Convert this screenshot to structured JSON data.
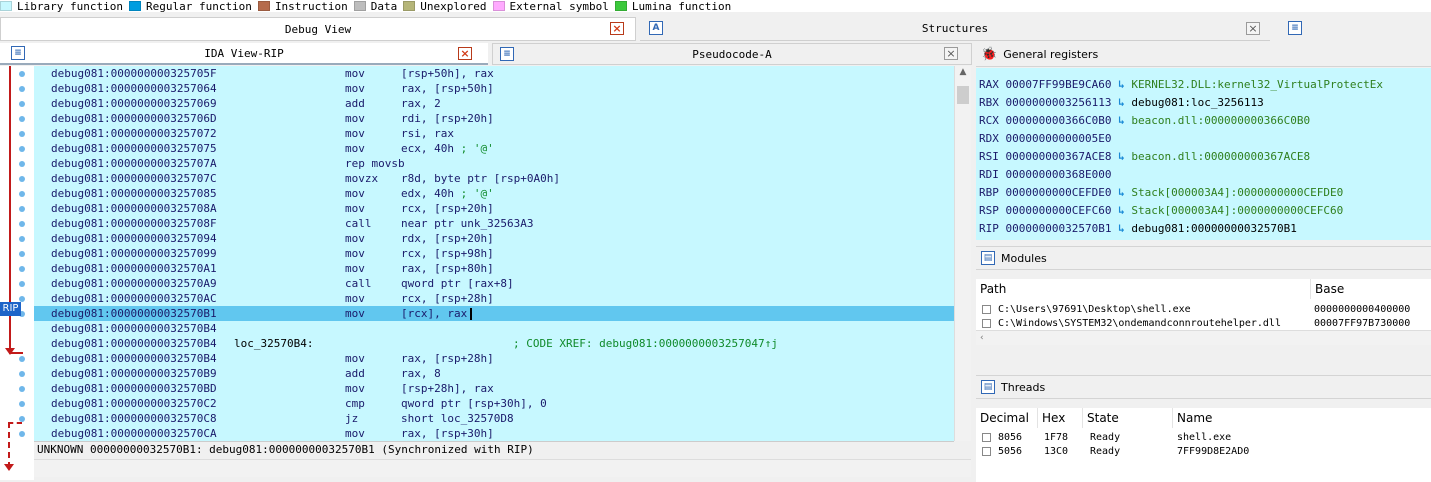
{
  "legend": [
    {
      "label": "Library function",
      "color": "#c7f8ff"
    },
    {
      "label": "Regular function",
      "color": "#009de0"
    },
    {
      "label": "Instruction",
      "color": "#b56b4c"
    },
    {
      "label": "Data",
      "color": "#bdbdbd"
    },
    {
      "label": "Unexplored",
      "color": "#b5b578"
    },
    {
      "label": "External symbol",
      "color": "#ffaaff"
    },
    {
      "label": "Lumina function",
      "color": "#3cc93c"
    }
  ],
  "tabs": {
    "debug_view": "Debug View",
    "structures": "Structures",
    "ida_view": "IDA View-RIP",
    "pseudocode": "Pseudocode-A"
  },
  "rip_badge": "RIP",
  "listing": [
    {
      "addr": "debug081:000000000325705F",
      "mn": "mov",
      "op": "[rsp+50h], rax"
    },
    {
      "addr": "debug081:0000000003257064",
      "mn": "mov",
      "op": "rax, [rsp+50h]"
    },
    {
      "addr": "debug081:0000000003257069",
      "mn": "add",
      "op": "rax, 2"
    },
    {
      "addr": "debug081:000000000325706D",
      "mn": "mov",
      "op": "rdi, [rsp+20h]"
    },
    {
      "addr": "debug081:0000000003257072",
      "mn": "mov",
      "op": "rsi, rax"
    },
    {
      "addr": "debug081:0000000003257075",
      "mn": "mov",
      "op": "ecx, 40h",
      "comment": " ; '@'"
    },
    {
      "addr": "debug081:000000000325707A",
      "mn": "rep movsb",
      "op": ""
    },
    {
      "addr": "debug081:000000000325707C",
      "mn": "movzx",
      "op": "r8d, byte ptr [rsp+0A0h]"
    },
    {
      "addr": "debug081:0000000003257085",
      "mn": "mov",
      "op": "edx, 40h",
      "comment": " ; '@'"
    },
    {
      "addr": "debug081:000000000325708A",
      "mn": "mov",
      "op": "rcx, [rsp+20h]"
    },
    {
      "addr": "debug081:000000000325708F",
      "mn": "call",
      "op": "near ptr unk_32563A3"
    },
    {
      "addr": "debug081:0000000003257094",
      "mn": "mov",
      "op": "rdx, [rsp+20h]"
    },
    {
      "addr": "debug081:0000000003257099",
      "mn": "mov",
      "op": "rcx, [rsp+98h]"
    },
    {
      "addr": "debug081:00000000032570A1",
      "mn": "mov",
      "op": "rax, [rsp+80h]"
    },
    {
      "addr": "debug081:00000000032570A9",
      "mn": "call",
      "op": "qword ptr [rax+8]"
    },
    {
      "addr": "debug081:00000000032570AC",
      "mn": "mov",
      "op": "rcx, [rsp+28h]"
    },
    {
      "addr": "debug081:00000000032570B1",
      "mn": "mov",
      "op": "[rcx], rax",
      "selected": true
    },
    {
      "addr": "debug081:00000000032570B4",
      "mn": "",
      "op": ""
    },
    {
      "addr": "debug081:00000000032570B4",
      "label": "loc_32570B4:",
      "mn": "",
      "op": "",
      "xref": "; CODE XREF: debug081:0000000003257047↑j"
    },
    {
      "addr": "debug081:00000000032570B4",
      "mn": "mov",
      "op": "rax, [rsp+28h]"
    },
    {
      "addr": "debug081:00000000032570B9",
      "mn": "add",
      "op": "rax, 8"
    },
    {
      "addr": "debug081:00000000032570BD",
      "mn": "mov",
      "op": "[rsp+28h], rax"
    },
    {
      "addr": "debug081:00000000032570C2",
      "mn": "cmp",
      "op": "qword ptr [rsp+30h], 0"
    },
    {
      "addr": "debug081:00000000032570C8",
      "mn": "jz",
      "op": "short loc_32570D8"
    },
    {
      "addr": "debug081:00000000032570CA",
      "mn": "mov",
      "op": "rax, [rsp+30h]"
    }
  ],
  "status": "UNKNOWN 00000000032570B1: debug081:00000000032570B1 (Synchronized with RIP)",
  "registers_pane": {
    "title": "General registers",
    "rows": [
      {
        "name": "RAX",
        "value": "00007FF99BE9CA60",
        "symbol": "KERNEL32.DLL:kernel32_VirtualProtectEx",
        "color": "green"
      },
      {
        "name": "RBX",
        "value": "0000000003256113",
        "symbol": "debug081:loc_3256113",
        "color": "black"
      },
      {
        "name": "RCX",
        "value": "000000000366C0B0",
        "symbol": "beacon.dll:000000000366C0B0",
        "color": "green"
      },
      {
        "name": "RDX",
        "value": "00000000000005E0",
        "symbol": "",
        "color": "black"
      },
      {
        "name": "RSI",
        "value": "000000000367ACE8",
        "symbol": "beacon.dll:000000000367ACE8",
        "color": "green"
      },
      {
        "name": "RDI",
        "value": "000000000368E000",
        "symbol": "",
        "color": "black"
      },
      {
        "name": "RBP",
        "value": "0000000000CEFDE0",
        "symbol": "Stack[000003A4]:0000000000CEFDE0",
        "color": "green"
      },
      {
        "name": "RSP",
        "value": "0000000000CEFC60",
        "symbol": "Stack[000003A4]:0000000000CEFC60",
        "color": "green"
      },
      {
        "name": "RIP",
        "value": "00000000032570B1",
        "symbol": "debug081:00000000032570B1",
        "color": "black"
      }
    ]
  },
  "modules_pane": {
    "title": "Modules",
    "columns": [
      "Path",
      "Base"
    ],
    "rows": [
      {
        "path": "C:\\Users\\97691\\Desktop\\shell.exe",
        "base": "0000000000400000"
      },
      {
        "path": "C:\\Windows\\SYSTEM32\\ondemandconnroutehelper.dll",
        "base": "00007FF97B730000"
      }
    ]
  },
  "threads_pane": {
    "title": "Threads",
    "columns": [
      "Decimal",
      "Hex",
      "State",
      "Name"
    ],
    "rows": [
      {
        "decimal": "8056",
        "hex": "1F78",
        "state": "Ready",
        "name": "shell.exe"
      },
      {
        "decimal": "5056",
        "hex": "13C0",
        "state": "Ready",
        "name": "7FF99D8E2AD0"
      }
    ]
  }
}
